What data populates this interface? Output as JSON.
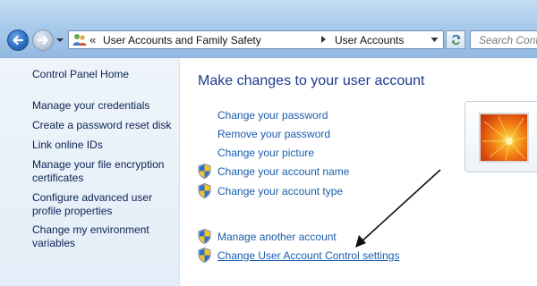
{
  "address_bar": {
    "breadcrumbs": [
      "User Accounts and Family Safety",
      "User Accounts"
    ],
    "overflow_glyph": "«"
  },
  "search": {
    "placeholder": "Search Control Panel"
  },
  "sidebar": {
    "home_label": "Control Panel Home",
    "links": [
      {
        "label": "Manage your credentials"
      },
      {
        "label": "Create a password reset disk"
      },
      {
        "label": "Link online IDs"
      },
      {
        "label": "Manage your file encryption certificates"
      },
      {
        "label": "Configure advanced user profile properties"
      },
      {
        "label": "Change my environment variables"
      }
    ]
  },
  "main": {
    "title": "Make changes to your user account",
    "actions": [
      {
        "label": "Change your password",
        "shield": false
      },
      {
        "label": "Remove your password",
        "shield": false
      },
      {
        "label": "Change your picture",
        "shield": false
      },
      {
        "label": "Change your account name",
        "shield": true
      },
      {
        "label": "Change your account type",
        "shield": true
      }
    ],
    "other_actions": [
      {
        "label": "Manage another account",
        "shield": true
      },
      {
        "label": "Change User Account Control settings",
        "shield": true
      }
    ]
  },
  "icons": {
    "back": "back-arrow-icon",
    "forward": "forward-arrow-icon",
    "shield": "uac-shield-icon",
    "refresh": "refresh-icon"
  },
  "colors": {
    "link": "#1a5dad",
    "title": "#1e3c8c",
    "sidebar_text": "#0b2252",
    "sidebar_bg": "#e4eef8"
  }
}
